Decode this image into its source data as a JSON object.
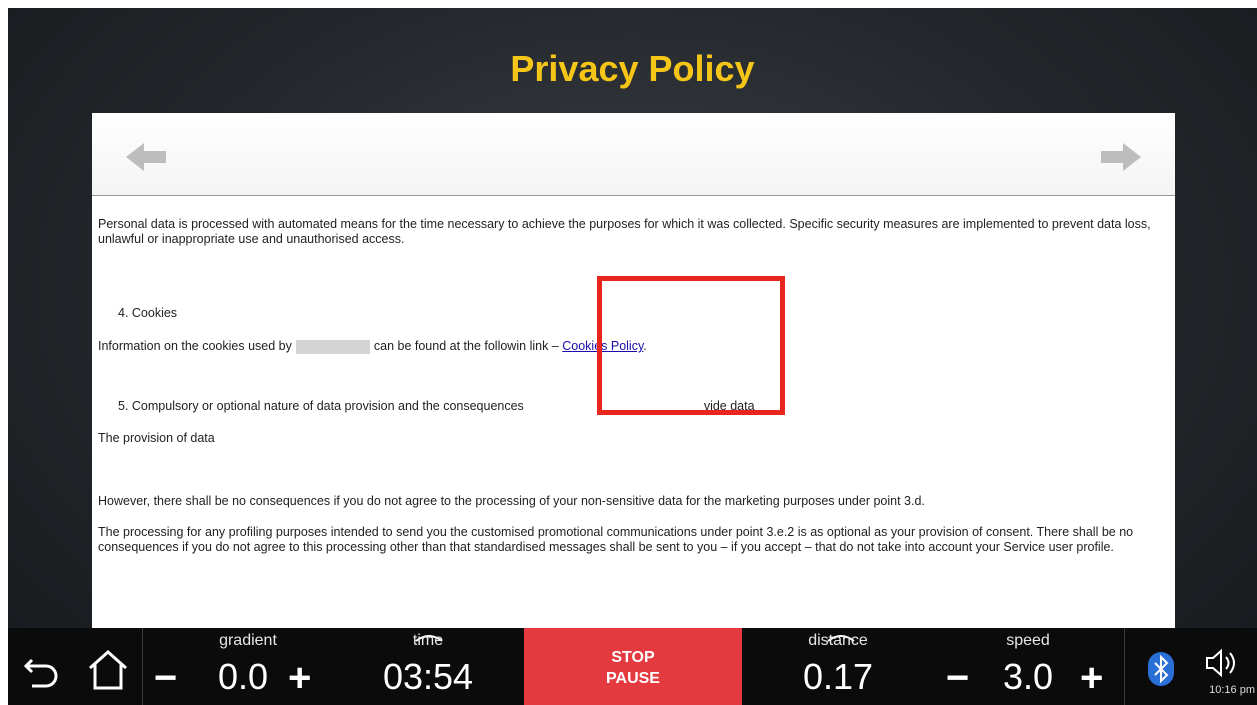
{
  "title": "Privacy Policy",
  "content": {
    "p1": "Personal data is processed with automated means for the time necessary to achieve the purposes for which it was collected. Specific security measures are implemented to prevent data loss, unlawful or inappropriate use and unauthorised access.",
    "h4": "4.  Cookies",
    "cookies_prefix": "Information on the cookies used by",
    "cookies_mid": "can be found at the followin",
    "cookies_mid2": "link –",
    "cookies_link": "Cookies Policy",
    "cookies_suffix": ".",
    "h5_a": "5.  Compulsory or optional nature of data provision and the consequences",
    "h5_b": "vide data",
    "provision": "The provision of data",
    "p_however": "However, there shall be no consequences if you do not agree to the processing of your non-sensitive data for the marketing purposes under point 3.d.",
    "p_profiling": "The processing for any profiling purposes intended to send you the customised promotional communications under point 3.e.2 is as optional as your provision of consent. There shall be no consequences if you do not agree to this processing other than that standardised messages shall be sent to you – if you accept – that do not take into account your Service user profile."
  },
  "bottombar": {
    "gradient_label": "gradient",
    "gradient_value": "0.0",
    "time_label": "time",
    "time_value": "03:54",
    "stop_label": "STOP",
    "pause_label": "PAUSE",
    "distance_label": "distance",
    "distance_value": "0.17",
    "speed_label": "speed",
    "speed_value": "3.0",
    "minus": "−",
    "plus": "+",
    "clock": "10:16 pm"
  },
  "colors": {
    "title": "#f5c518",
    "stop_button": "#e53940",
    "highlight": "#e8261e",
    "link": "#1a0dab",
    "bluetooth": "#2a6fd6"
  },
  "icons": [
    "arrow-left-icon",
    "arrow-right-icon",
    "back-icon",
    "home-icon",
    "bluetooth-icon",
    "volume-icon",
    "expand-icon"
  ]
}
